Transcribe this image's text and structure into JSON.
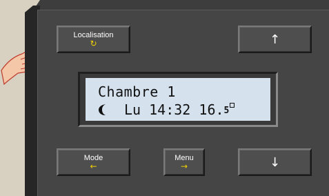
{
  "buttons": {
    "localisation": {
      "label": "Localisation",
      "symbol": "↻"
    },
    "up": {
      "symbol": "↑"
    },
    "mode": {
      "label": "Mode",
      "symbol": "←"
    },
    "menu": {
      "label": "Menu",
      "symbol": "→"
    },
    "down": {
      "symbol": "↓"
    }
  },
  "display": {
    "room": "Chambre 1",
    "mode_icon": "moon-icon",
    "day": "Lu",
    "time": "14:32",
    "temperature_int": "16.",
    "temperature_dec": "5"
  },
  "colors": {
    "background": "#d8d1c2",
    "device": "#454545",
    "lcd": "#d5e2ee",
    "button_symbol": "#f0d000"
  }
}
